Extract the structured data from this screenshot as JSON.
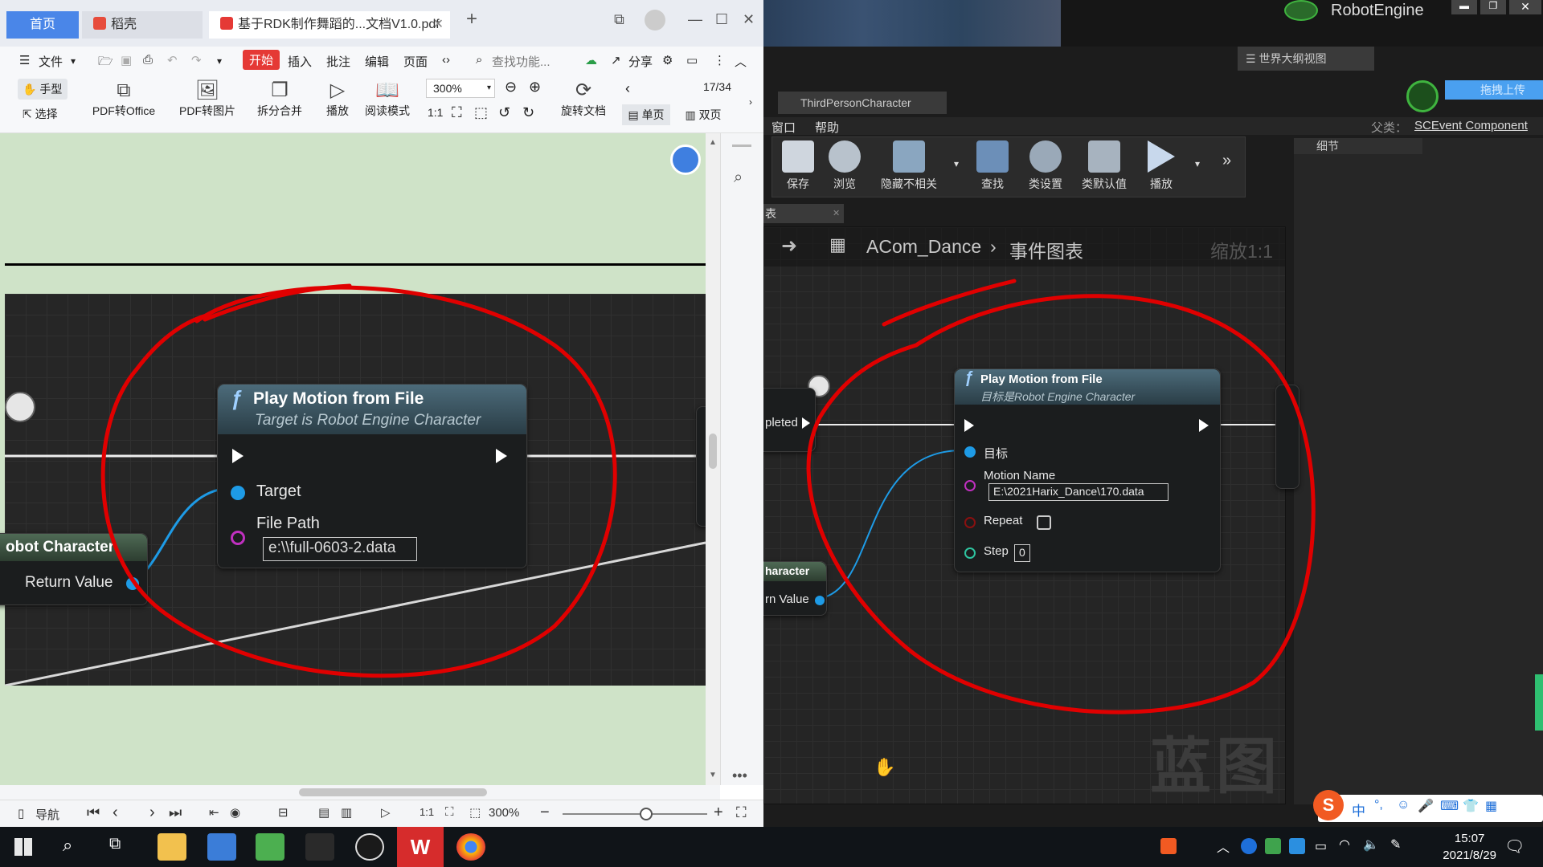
{
  "wps": {
    "tabs": {
      "home": "首页",
      "daoke": "稻壳",
      "doc": "基于RDK制作舞蹈的...文档V1.0.pdf"
    },
    "menu": {
      "file": "文件",
      "start": "开始",
      "insert": "插入",
      "annotate": "批注",
      "edit": "编辑",
      "page": "页面",
      "search_placeholder": "查找功能...",
      "share": "分享"
    },
    "tools": {
      "hand": "手型",
      "select": "选择",
      "pdf_to_office": "PDF转Office",
      "pdf_to_image": "PDF转图片",
      "split_merge": "拆分合并",
      "play": "播放",
      "reading_mode": "阅读模式",
      "zoom": "300%",
      "rotate": "旋转文档",
      "page_counter": "17/34",
      "single_page": "单页",
      "double_page": "双页"
    },
    "status": {
      "nav": "导航",
      "zoom": "300%"
    },
    "pdf_blueprint": {
      "node_title": "Play Motion from File",
      "node_subtitle": "Target is Robot Engine Character",
      "pin_target": "Target",
      "pin_file_path": "File Path",
      "file_path_value": "e:\\\\full-0603-2.data",
      "left_node_title": "obot Character",
      "left_node_pin": "Return Value"
    }
  },
  "ue": {
    "title": "RobotEngine",
    "outline_tab": "世界大纲视图",
    "upload": "拖拽上传",
    "char_tab": "ThirdPersonCharacter",
    "menu": {
      "window": "窗口",
      "help": "帮助",
      "parent_label": "父类：",
      "parent_value": "SCEvent Component"
    },
    "toolbar": {
      "save": "保存",
      "browse": "浏览",
      "hide_unrelated": "隐藏不相关",
      "find": "查找",
      "class_settings": "类设置",
      "class_defaults": "类默认值",
      "play": "播放"
    },
    "details_tab": "细节",
    "graph_tab": "表",
    "breadcrumb": {
      "root": "ACom_Dance",
      "leaf": "事件图表",
      "zoom": "缩放1:1"
    },
    "watermark": "蓝图",
    "node": {
      "title": "Play Motion from File",
      "subtitle": "目标是Robot Engine Character",
      "pin_target": "目标",
      "pin_motion_name": "Motion Name",
      "motion_name_value": "E:\\2021Harix_Dance\\170.data",
      "pin_repeat": "Repeat",
      "pin_step": "Step",
      "step_value": "0"
    },
    "left_node": {
      "completed": "pleted",
      "title": "haracter",
      "pin": "rn Value"
    }
  },
  "taskbar": {
    "time": "15:07",
    "date": "2021/8/29",
    "ime_lang": "中"
  },
  "colors": {
    "annotation_red": "#e00000",
    "wps_accent": "#4a86e8",
    "pin_blue": "#1e9be6",
    "pin_magenta": "#c030c0",
    "pin_teal": "#2ec4a0",
    "pin_darkred": "#8a1010"
  }
}
